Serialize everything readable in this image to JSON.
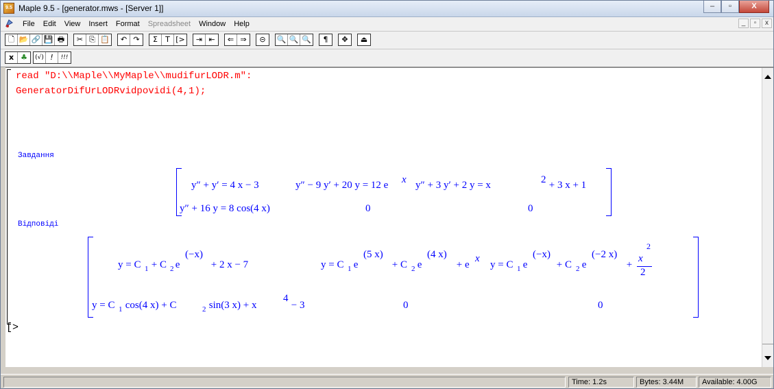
{
  "window": {
    "title": "Maple 9.5  - [generator.mws - [Server 1]]",
    "app_icon_text": "9.5",
    "buttons": [
      "–",
      "▫",
      "X"
    ]
  },
  "menubar": {
    "items": [
      {
        "label": "File",
        "enabled": true
      },
      {
        "label": "Edit",
        "enabled": true
      },
      {
        "label": "View",
        "enabled": true
      },
      {
        "label": "Insert",
        "enabled": true
      },
      {
        "label": "Format",
        "enabled": true
      },
      {
        "label": "Spreadsheet",
        "enabled": false
      },
      {
        "label": "Window",
        "enabled": true
      },
      {
        "label": "Help",
        "enabled": true
      }
    ],
    "mdi_buttons": [
      "_",
      "▫",
      "x"
    ]
  },
  "toolbar": {
    "groups": [
      [
        "new-icon",
        "open-icon",
        "open-url-icon",
        "save-icon",
        "print-icon"
      ],
      [
        "cut-icon",
        "copy-icon",
        "paste-icon"
      ],
      [
        "undo-icon",
        "redo-icon"
      ],
      [
        "math-input-icon",
        "text-input-icon",
        "execution-group-icon"
      ],
      [
        "indent-icon",
        "outdent-icon"
      ],
      [
        "back-icon",
        "forward-icon"
      ],
      [
        "stop-icon"
      ],
      [
        "zoom-small-icon",
        "zoom-medium-icon",
        "zoom-large-icon"
      ],
      [
        "show-markers-icon"
      ],
      [
        "expand-icon"
      ],
      [
        "restart-icon"
      ]
    ],
    "glyphs": {
      "new-icon": "🗋",
      "open-icon": "📂",
      "open-url-icon": "🔗",
      "save-icon": "💾",
      "print-icon": "🖶",
      "cut-icon": "✂",
      "copy-icon": "⎘",
      "paste-icon": "📋",
      "undo-icon": "↶",
      "redo-icon": "↷",
      "math-input-icon": "Σ",
      "text-input-icon": "T",
      "execution-group-icon": "[>",
      "indent-icon": "⇥",
      "outdent-icon": "⇤",
      "back-icon": "⇐",
      "forward-icon": "⇒",
      "stop-icon": "⊝",
      "zoom-small-icon": "🔍",
      "zoom-medium-icon": "🔍",
      "zoom-large-icon": "🔍",
      "show-markers-icon": "¶",
      "expand-icon": "✥",
      "restart-icon": "⏏"
    }
  },
  "contextbar": {
    "buttons": [
      {
        "name": "text-mode-icon",
        "glyph": "x"
      },
      {
        "name": "maple-leaf-icon",
        "glyph": "♣"
      },
      {
        "name": "correct-syntax-icon",
        "glyph": "(√)"
      },
      {
        "name": "execute-icon",
        "glyph": "!"
      },
      {
        "name": "execute-all-icon",
        "glyph": "!!!"
      }
    ]
  },
  "worksheet": {
    "input_lines": [
      "read \"D:\\\\Maple\\\\MyMaple\\\\mudifurLODR.m\":",
      "GeneratorDifUrLODRvidpovidi(4,1);"
    ],
    "label_tasks": "Завдання",
    "label_answers": "Відповіді",
    "tasks_matrix": {
      "row1": [
        "y″ + y′ = 4 x − 3",
        "y″ − 9 y′ + 20 y = 12 e",
        "y″ + 3 y′ + 2 y = x",
        " + 3 x + 1"
      ],
      "row1_sups": [
        "x",
        "2"
      ],
      "row2": [
        "y″ + 16 y = 8 cos(4 x)",
        "0",
        "0"
      ]
    },
    "answers_matrix": {
      "row1_a": [
        "y = C",
        "1",
        " + C",
        "2",
        " e",
        "(−x)",
        " + 2 x − 7"
      ],
      "row1_b": [
        "y = C",
        "1",
        " e",
        "(5 x)",
        " + C",
        "2",
        " e",
        "(4 x)",
        " + e",
        "x"
      ],
      "row1_c": [
        "y = C",
        "1",
        " e",
        "(−x)",
        " + C",
        "2",
        " e",
        "(−2 x)",
        " + ",
        "x",
        "2",
        "2"
      ],
      "row2": [
        "y = C",
        "1",
        " cos(4 x) + C",
        "2",
        " sin(3 x) + x",
        "4",
        " − 3",
        "0",
        "0"
      ]
    },
    "prompt": "[>"
  },
  "statusbar": {
    "time": "Time:  1.2s",
    "bytes": "Bytes: 3.44M",
    "available": "Available: 4.00G"
  }
}
